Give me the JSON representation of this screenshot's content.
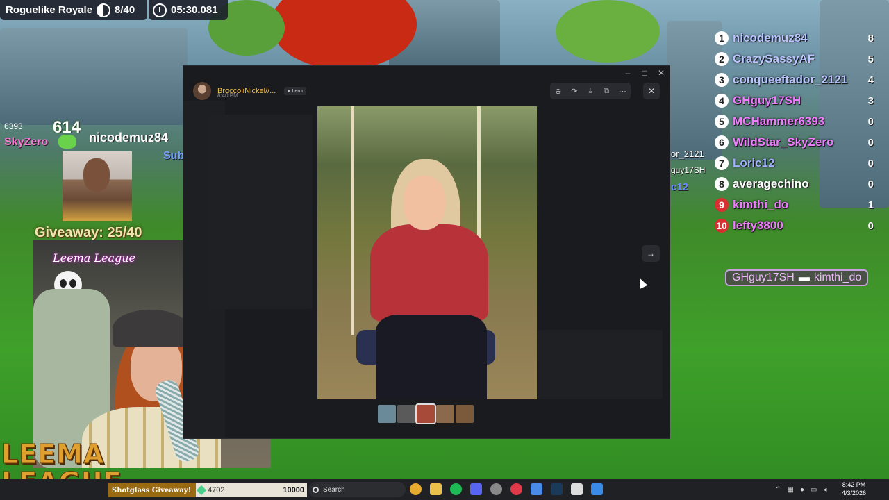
{
  "hud": {
    "game_title": "Roguelike Royale",
    "players_remaining": "8/40",
    "timer": "05:30.081"
  },
  "leaderboard": [
    {
      "rank": "1",
      "name": "nicodemuz84",
      "score": "8",
      "color": "#b9c6ff"
    },
    {
      "rank": "2",
      "name": "CrazySassyAF",
      "score": "5",
      "color": "#b9c6ff"
    },
    {
      "rank": "3",
      "name": "conqueeftador_2121",
      "score": "4",
      "color": "#b9c6ff"
    },
    {
      "rank": "4",
      "name": "GHguy17SH",
      "score": "3",
      "color": "#f07cff"
    },
    {
      "rank": "5",
      "name": "MCHammer6393",
      "score": "0",
      "color": "#f07cff"
    },
    {
      "rank": "6",
      "name": "WildStar_SkyZero",
      "score": "0",
      "color": "#f07cff"
    },
    {
      "rank": "7",
      "name": "Loric12",
      "score": "0",
      "color": "#9fb3ff"
    },
    {
      "rank": "8",
      "name": "averagechino",
      "score": "0",
      "color": "#ffffff"
    },
    {
      "rank": "9",
      "name": "kimthi_do",
      "score": "1",
      "color": "#f07cff"
    },
    {
      "rank": "10",
      "name": "lefty3800",
      "score": "0",
      "color": "#f07cff"
    }
  ],
  "kill_feed": {
    "attacker": "GHguy17SH",
    "victim": "kimthi_do"
  },
  "player_tag": {
    "score": "614",
    "name": "nicodemuz84"
  },
  "side_labels": {
    "left_number": "6393",
    "left_name": "SkyZero",
    "sub_label": "Sub",
    "behind_1": "or_2121",
    "behind_2": "guy17SH",
    "behind_3": "c12"
  },
  "giveaway": "Giveaway: 25/40",
  "webcam": {
    "sign": "Leema League"
  },
  "logo": {
    "line1": "LEEMA",
    "line2": "LEAGUE"
  },
  "viewer": {
    "username": "BroccoliNickel//...",
    "time": "8:40 PM",
    "server": "Lemr",
    "tools": [
      "zoom-icon",
      "forward-icon",
      "download-icon",
      "open-icon",
      "more-icon"
    ],
    "close": "✕",
    "next": "→"
  },
  "window_controls": [
    "–",
    "□",
    "✕"
  ],
  "taskbar": {
    "shotglass_label": "Shotglass Giveaway!",
    "shotglass_current": "4702",
    "shotglass_goal": "10000",
    "search_label": "Search",
    "time": "8:42 PM",
    "date": "4/3/2026"
  }
}
